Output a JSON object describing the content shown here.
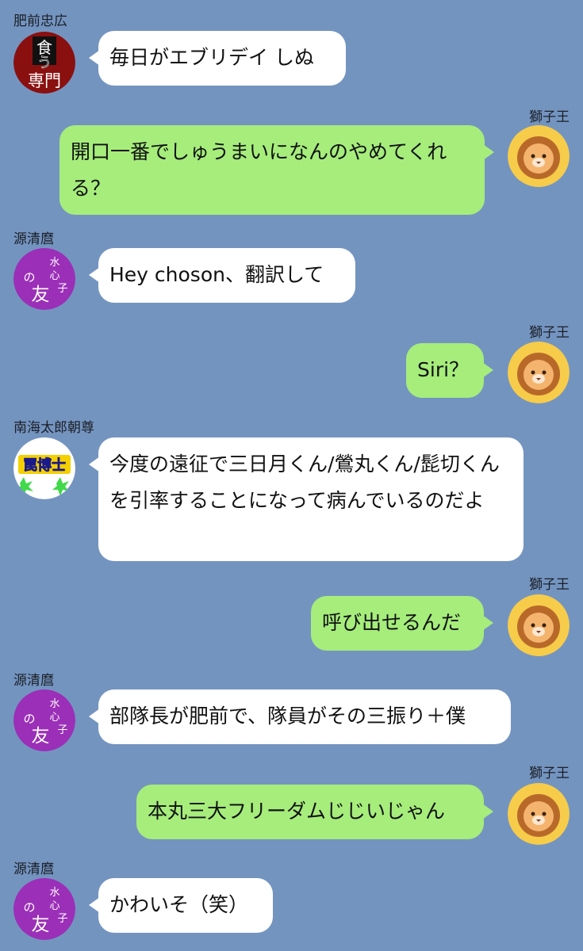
{
  "chat": {
    "messages": [
      {
        "sender": "肥前忠広",
        "text": "毎日がエブリデイ しぬ"
      },
      {
        "sender": "獅子王",
        "text": "開口一番でしゅうまいになんのやめてくれる？"
      },
      {
        "sender": "源清麿",
        "text": "Hey choson、翻訳して"
      },
      {
        "sender": "獅子王",
        "text": "Siri？"
      },
      {
        "sender": "南海太郎朝尊",
        "text": "今度の遠征で三日月くん/鶯丸くん/髭切くんを引率することになって病んでいるのだよ"
      },
      {
        "sender": "獅子王",
        "text": "呼び出せるんだ"
      },
      {
        "sender": "源清麿",
        "text": "部隊長が肥前で、隊員がその三振り＋僕"
      },
      {
        "sender": "獅子王",
        "text": "本丸三大フリーダムじじいじゃん"
      },
      {
        "sender": "源清麿",
        "text": "かわいそ（笑）"
      }
    ]
  },
  "avatars": {
    "hizen": {
      "icon": "food-specialist-avatar",
      "text_top": "食",
      "text_mid": "う",
      "text_bottom": "専門"
    },
    "kiyomaro": {
      "icon": "mizushinshi-friend-avatar",
      "text_a": "水",
      "text_b": "心",
      "text_c": "子",
      "text_d": "の",
      "text_e": "友"
    },
    "nankai": {
      "icon": "trap-doctor-avatar",
      "text": "罠博士"
    },
    "shishio": {
      "icon": "lion-avatar"
    }
  },
  "colors": {
    "background": "#7494c0",
    "bubble_left": "#ffffff",
    "bubble_right": "#a6ed7c"
  }
}
